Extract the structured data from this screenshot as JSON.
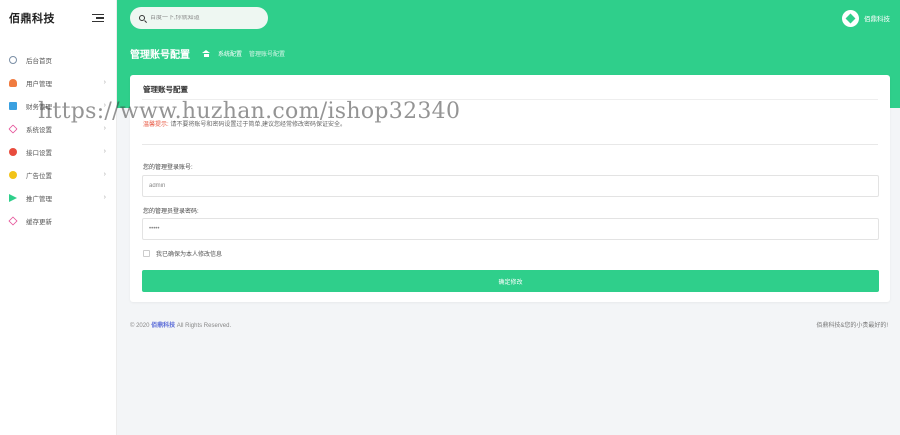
{
  "brand": {
    "name": "佰鼎科技"
  },
  "search": {
    "placeholder": "百度一下,你就知道"
  },
  "user": {
    "name": "佰鼎科技"
  },
  "sidebar": {
    "items": [
      {
        "label": "后台首页",
        "icon": "dashboard-icon",
        "has_children": false
      },
      {
        "label": "用户管理",
        "icon": "user-icon",
        "has_children": true
      },
      {
        "label": "财务管理",
        "icon": "finance-icon",
        "has_children": true
      },
      {
        "label": "系统设置",
        "icon": "settings-icon",
        "has_children": true
      },
      {
        "label": "接口设置",
        "icon": "port-icon",
        "has_children": true
      },
      {
        "label": "广告位置",
        "icon": "ad-icon",
        "has_children": true
      },
      {
        "label": "推广管理",
        "icon": "promo-icon",
        "has_children": true
      },
      {
        "label": "缓存更新",
        "icon": "cache-icon",
        "has_children": false
      }
    ],
    "chevron": "›"
  },
  "page": {
    "title": "管理账号配置",
    "breadcrumbs": [
      "系统配置",
      "管理账号配置"
    ]
  },
  "card": {
    "title": "管理账号配置",
    "tip_warn": "温馨提示:",
    "tip_text": "请不要将账号和密码设置过于简单,建议您经常修改密码保证安全。",
    "field1_label": "您的管理登录账号:",
    "field1_value": "admin",
    "field2_label": "您的管理员登录密码:",
    "field2_value": "•••••",
    "checkbox_label": "我已确保为本人修改信息",
    "submit_label": "确定修改"
  },
  "footer": {
    "copyright_prefix": "© 2020",
    "copyright_link": "佰鼎科技",
    "copyright_suffix": "All Rights Reserved.",
    "right_text": "佰鼎科技&您的小贵最好的!"
  },
  "watermark": {
    "text": "https://www.huzhan.com/ishop32340"
  },
  "colors": {
    "accent": "#2fcf8b",
    "warn": "#e8553f",
    "link": "#5b6cd8"
  }
}
